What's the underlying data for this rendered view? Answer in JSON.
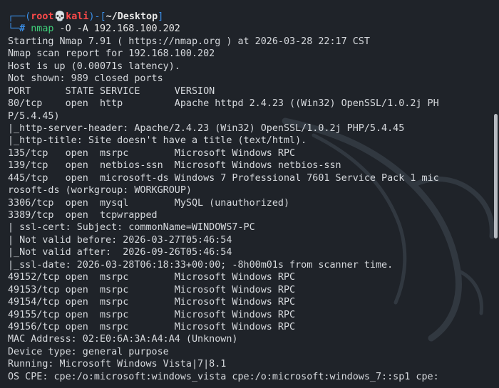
{
  "prompt": {
    "user": "root",
    "host": "kali",
    "path": "~/Desktop",
    "symbol": "#",
    "command": "nmap",
    "args": " -O -A 192.168.100.202"
  },
  "output": [
    "Starting Nmap 7.91 ( https://nmap.org ) at 2026-03-28 22:17 CST",
    "Nmap scan report for 192.168.100.202",
    "Host is up (0.00071s latency).",
    "Not shown: 989 closed ports",
    "PORT      STATE SERVICE      VERSION",
    "80/tcp    open  http         Apache httpd 2.4.23 ((Win32) OpenSSL/1.0.2j PH",
    "P/5.4.45)",
    "|_http-server-header: Apache/2.4.23 (Win32) OpenSSL/1.0.2j PHP/5.4.45",
    "|_http-title: Site doesn't have a title (text/html).",
    "135/tcp   open  msrpc        Microsoft Windows RPC",
    "139/tcp   open  netbios-ssn  Microsoft Windows netbios-ssn",
    "445/tcp   open  microsoft-ds Windows 7 Professional 7601 Service Pack 1 mic",
    "rosoft-ds (workgroup: WORKGROUP)",
    "3306/tcp  open  mysql        MySQL (unauthorized)",
    "3389/tcp  open  tcpwrapped",
    "| ssl-cert: Subject: commonName=WINDOWS7-PC",
    "| Not valid before: 2026-03-27T05:46:54",
    "|_Not valid after:  2026-09-26T05:46:54",
    "|_ssl-date: 2026-03-28T06:18:33+00:00; -8h00m01s from scanner time.",
    "49152/tcp open  msrpc        Microsoft Windows RPC",
    "49153/tcp open  msrpc        Microsoft Windows RPC",
    "49154/tcp open  msrpc        Microsoft Windows RPC",
    "49155/tcp open  msrpc        Microsoft Windows RPC",
    "49156/tcp open  msrpc        Microsoft Windows RPC",
    "MAC Address: 02:E0:6A:3A:A4:A4 (Unknown)",
    "Device type: general purpose",
    "Running: Microsoft Windows Vista|7|8.1",
    "OS CPE: cpe:/o:microsoft:windows_vista cpe:/o:microsoft:windows_7::sp1 cpe:"
  ],
  "colors": {
    "background": "#1f2329",
    "prompt_frame": "#3a8ee6",
    "prompt_user": "#ff4a4a",
    "command": "#3fd07a",
    "text": "#d6d9dd"
  },
  "icons": {
    "prompt_separator": "skull-icon",
    "watermark": "kali-dragon-watermark"
  }
}
